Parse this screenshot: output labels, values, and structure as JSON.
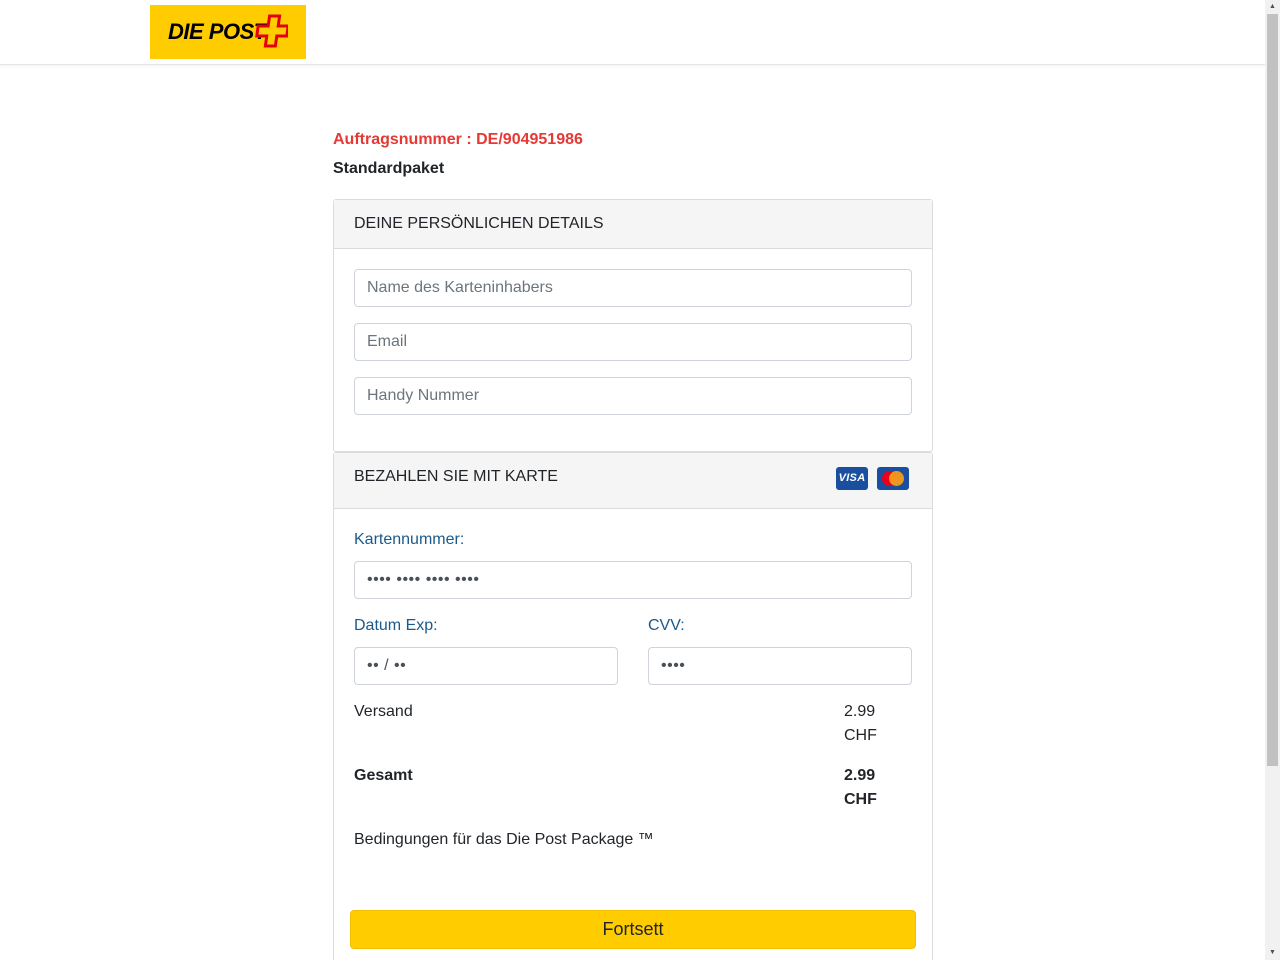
{
  "header": {
    "logo_text": "DIE POST",
    "brand_color": "#ffcc00"
  },
  "order": {
    "number_label": "Auftragsnummer : DE/904951986",
    "package_type": "Standardpaket"
  },
  "details_panel": {
    "title": "DEINE PERSÖNLICHEN DETAILS",
    "name_placeholder": "Name des Karteninhabers",
    "email_placeholder": "Email",
    "phone_placeholder": "Handy Nummer"
  },
  "payment_panel": {
    "title": "BEZAHLEN SIE MIT KARTE",
    "card_brands": [
      "visa-icon",
      "mastercard-icon"
    ],
    "visa_text": "VISA",
    "card_number_label": "Kartennummer:",
    "card_number_placeholder": "•••• •••• •••• ••••",
    "expiry_label": "Datum Exp:",
    "expiry_placeholder": "•• / ••",
    "cvv_label": "CVV:",
    "cvv_placeholder": "••••",
    "shipping_label": "Versand",
    "shipping_amount": "2.99 CHF",
    "total_label": "Gesamt",
    "total_amount": "2.99 CHF",
    "terms_text": "Bedingungen für das Die Post Package ™",
    "submit_label": "Fortsett"
  },
  "colors": {
    "accent_yellow": "#ffcc00",
    "order_red": "#e53935",
    "label_blue": "#1b5a8a"
  }
}
